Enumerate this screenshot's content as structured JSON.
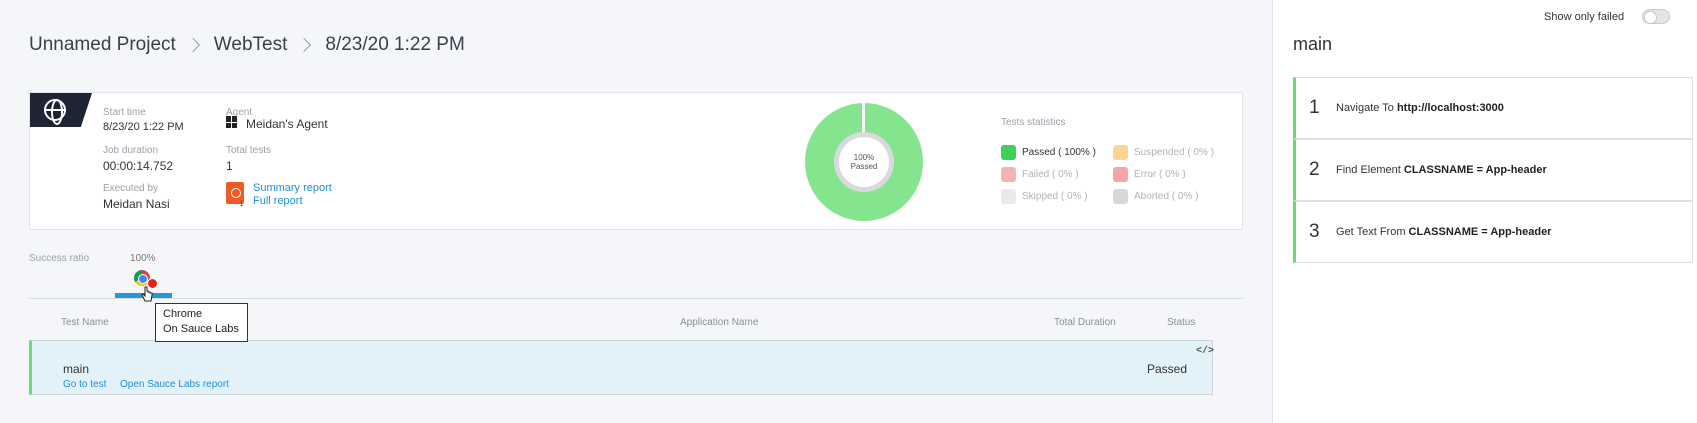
{
  "breadcrumb": {
    "project": "Unnamed Project",
    "section": "WebTest",
    "run": "8/23/20 1:22 PM"
  },
  "summary": {
    "start_time_label": "Start time",
    "start_time": "8/23/20 1:22 PM",
    "job_duration_label": "Job duration",
    "job_duration": "00:00:14.752",
    "executed_by_label": "Executed by",
    "executed_by": "Meidan Nasi",
    "agent_label": "Agent",
    "agent": "Meidan's Agent",
    "total_tests_label": "Total tests",
    "total_tests": "1",
    "summary_report": "Summary report",
    "full_report": "Full report"
  },
  "donut": {
    "percent": "100%",
    "label": "Passed",
    "passed_fraction": 1.0
  },
  "stats": {
    "title": "Tests statistics",
    "items": [
      {
        "label": "Passed ( 100% )",
        "color": "#3dd15a",
        "text_color": "#333333"
      },
      {
        "label": "Suspended ( 0% )",
        "color": "#fbd596",
        "text_color": "#b0b4ba"
      },
      {
        "label": "Failed ( 0% )",
        "color": "#f7b3b3",
        "text_color": "#b0b4ba"
      },
      {
        "label": "Error ( 0% )",
        "color": "#f4a5a5",
        "text_color": "#b0b4ba"
      },
      {
        "label": "Skipped ( 0% )",
        "color": "#e9eaec",
        "text_color": "#b0b4ba"
      },
      {
        "label": "Aborted ( 0% )",
        "color": "#d6d7da",
        "text_color": "#b0b4ba"
      }
    ]
  },
  "success_ratio": {
    "label": "Success ratio",
    "value": "100%"
  },
  "tooltip": {
    "line1": "Chrome",
    "line2": "On Sauce Labs"
  },
  "table": {
    "headers": [
      "Test Name",
      "Application Name",
      "Total Duration",
      "Status"
    ],
    "rows": [
      {
        "name": "main",
        "status": "Passed",
        "go_to_test": "Go to test",
        "open_report": "Open Sauce Labs report"
      }
    ]
  },
  "right_panel": {
    "toggle_label": "Show only failed",
    "title": "main",
    "steps": [
      {
        "num": "1",
        "action": "Navigate To",
        "arg": "http://localhost:3000"
      },
      {
        "num": "2",
        "action": "Find Element",
        "arg": "CLASSNAME = App-header"
      },
      {
        "num": "3",
        "action": "Get Text From",
        "arg": "CLASSNAME = App-header"
      }
    ]
  },
  "icons": {
    "platform": "globe-icon",
    "agent_os": "windows-icon",
    "report": "pdf-icon",
    "browser": "chrome-icon",
    "provider": "sauce-labs-icon",
    "code": "code-icon"
  }
}
